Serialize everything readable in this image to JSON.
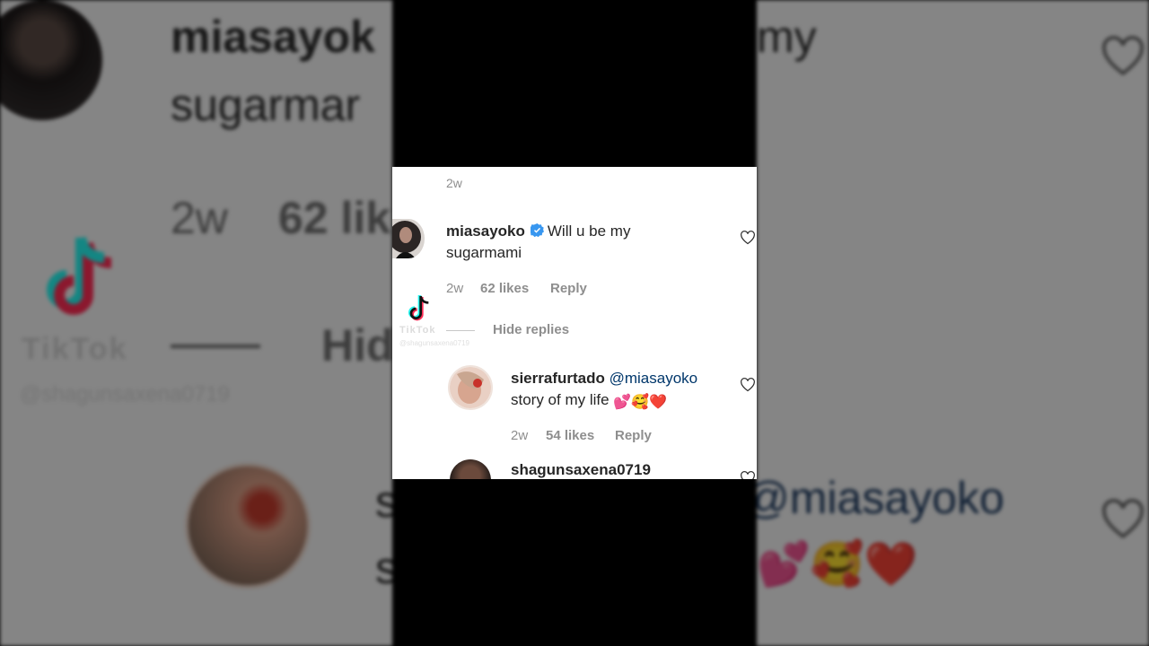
{
  "watermark": {
    "brand": "TikTok",
    "handle": "@shagunsaxena0719"
  },
  "top_comment_time": "2w",
  "comment_main": {
    "username": "miasayoko",
    "verified": true,
    "text": "Will u be my sugarmami",
    "text_line1": "Will u be my",
    "text_line2": "sugarmami",
    "time": "2w",
    "likes": "62 likes",
    "reply_label": "Reply"
  },
  "hide_replies_label": "Hide replies",
  "reply_1": {
    "username": "sierrafurtado",
    "mention": "@miasayoko",
    "text": "story of my life",
    "emojis": "💕🥰❤️",
    "time": "2w",
    "likes": "54 likes",
    "reply_label": "Reply"
  },
  "reply_2": {
    "username": "shagunsaxena0719"
  },
  "background": {
    "username_partial": "miasayok",
    "right_text_1": "my",
    "text_partial_line2": "sugarmar",
    "time": "2w",
    "likes_partial": "62 lik",
    "hide_partial": "Hid",
    "mention": "@miasayoko",
    "reply_initial_1": "s",
    "reply_initial_2": "s"
  },
  "colors": {
    "verified_blue": "#3897f0",
    "meta_gray": "#8e8e8e",
    "mention_blue": "#00376b",
    "letterbox": "#000000"
  }
}
